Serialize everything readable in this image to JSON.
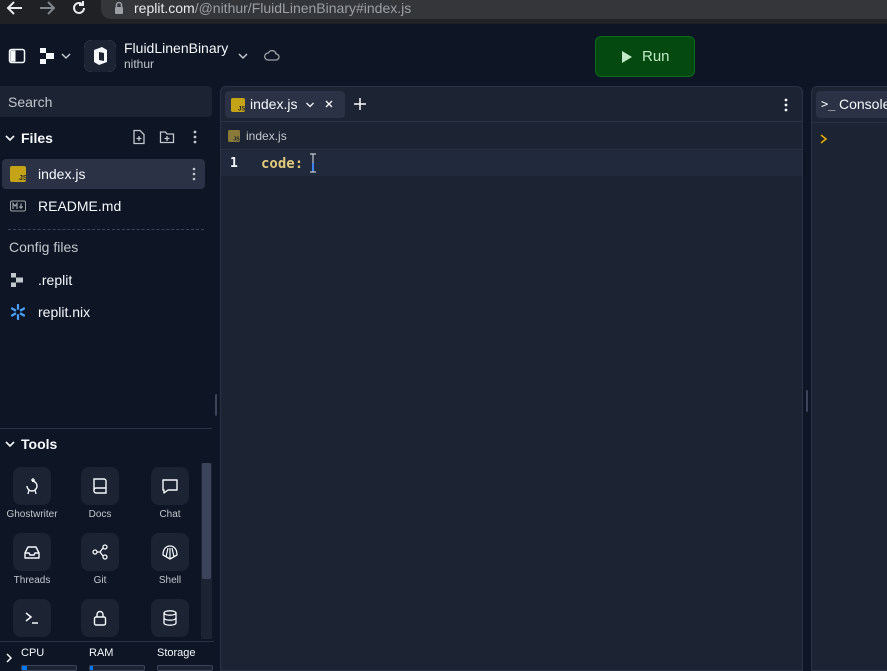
{
  "browser": {
    "url_host": "replit.com",
    "url_path": "/@nithur/FluidLinenBinary#index.js",
    "back_icon": "arrow-left-icon",
    "forward_icon": "arrow-right-icon",
    "reload_icon": "reload-icon",
    "lock_icon": "lock-icon"
  },
  "header": {
    "repl_name": "FluidLinenBinary",
    "repl_owner": "nithur",
    "run_label": "Run",
    "run_color": "#044a10"
  },
  "sidebar": {
    "search_placeholder": "Search",
    "files_title": "Files",
    "files": [
      {
        "label": "index.js",
        "icon": "js-file-icon",
        "active": true
      },
      {
        "label": "README.md",
        "icon": "markdown-file-icon",
        "active": false
      }
    ],
    "config_title": "Config files",
    "config_files": [
      {
        "label": ".replit",
        "icon": "replit-config-icon"
      },
      {
        "label": "replit.nix",
        "icon": "nix-snowflake-icon"
      }
    ],
    "tools_title": "Tools",
    "tools": [
      {
        "label": "Ghostwriter",
        "icon": "ghostwriter-icon"
      },
      {
        "label": "Docs",
        "icon": "docs-icon"
      },
      {
        "label": "Chat",
        "icon": "chat-icon"
      },
      {
        "label": "Threads",
        "icon": "threads-icon"
      },
      {
        "label": "Git",
        "icon": "git-icon"
      },
      {
        "label": "Shell",
        "icon": "shell-icon"
      },
      {
        "label": "",
        "icon": "console-icon"
      },
      {
        "label": "",
        "icon": "lock-icon"
      },
      {
        "label": "",
        "icon": "database-icon"
      }
    ],
    "resources": [
      {
        "label": "CPU",
        "level": 0.1
      },
      {
        "label": "RAM",
        "level": 0.05
      },
      {
        "label": "Storage",
        "level": 0.0
      }
    ]
  },
  "editor": {
    "tab_label": "index.js",
    "breadcrumb": "index.js",
    "lines": [
      {
        "number": "1",
        "text": "code: "
      }
    ]
  },
  "console": {
    "tab_icon": ">_",
    "tab_label": "Console"
  },
  "colors": {
    "background": "#0e1525",
    "panel": "#1c2333",
    "active_item": "#2b3245",
    "accent_blue": "#0079f2",
    "js_badge": "#c4a316"
  }
}
